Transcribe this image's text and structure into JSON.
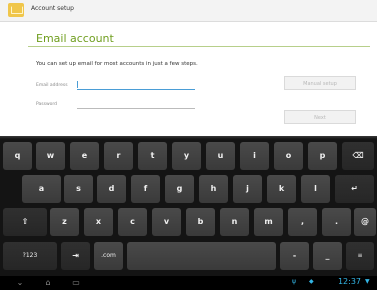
{
  "action_bar": {
    "title": "Account setup",
    "app_icon": "email-app-icon"
  },
  "form": {
    "heading": "Email account",
    "intro": "You can set up email for most accounts in just a few steps.",
    "email_label": "Email address",
    "email_value": "",
    "password_label": "Password",
    "password_value": "",
    "manual_setup_label": "Manual setup",
    "next_label": "Next"
  },
  "keyboard": {
    "row1": [
      "q",
      "w",
      "e",
      "r",
      "t",
      "y",
      "u",
      "i",
      "o",
      "p"
    ],
    "row2": [
      "a",
      "s",
      "d",
      "f",
      "g",
      "h",
      "j",
      "k",
      "l"
    ],
    "row3": [
      "z",
      "x",
      "c",
      "v",
      "b",
      "n",
      "m",
      ",",
      "."
    ],
    "symbols_label": "?123",
    "tab_glyph": "⇥",
    "dotcom_label": ".com",
    "backspace_glyph": "⌫",
    "enter_glyph": "↵",
    "shift_glyph": "⇧",
    "at_label": "@",
    "minus_label": "-",
    "underscore_label": "_",
    "settings_glyph": "≡"
  },
  "status_bar": {
    "time": "12:37",
    "nav_back_icon": "back-icon",
    "nav_home_icon": "home-icon",
    "nav_recent_icon": "recent-apps-icon"
  },
  "colors": {
    "accent_green": "#6f9e1e",
    "focus_blue": "#4a9dd6",
    "clock_blue": "#33b5e5"
  }
}
